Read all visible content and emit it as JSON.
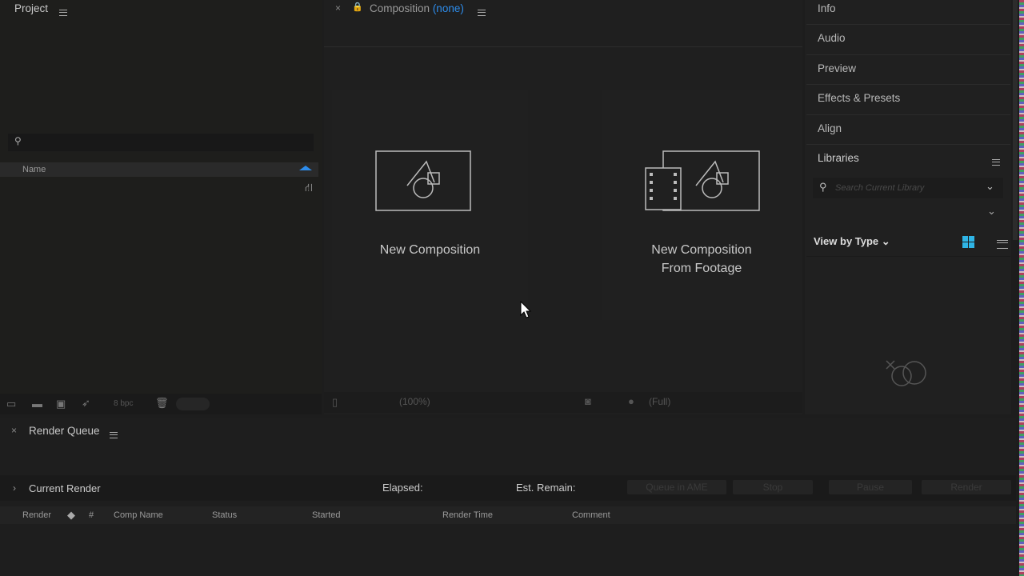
{
  "project": {
    "title": "Project",
    "column_name": "Name",
    "bpc": "8 bpc"
  },
  "composition": {
    "title": "Composition",
    "comp_name": "(none)",
    "zoom": "(100%)",
    "resolution": "(Full)",
    "new_comp": "New Composition",
    "new_comp_footage_line1": "New Composition",
    "new_comp_footage_line2": "From Footage"
  },
  "right_panels": {
    "items": [
      "Info",
      "Audio",
      "Preview",
      "Effects & Presets",
      "Align",
      "Libraries"
    ],
    "search_placeholder": "Search Current Library",
    "view_by": "View by Type"
  },
  "render_queue": {
    "title": "Render Queue",
    "current_render": "Current Render",
    "elapsed": "Elapsed:",
    "est_remain": "Est. Remain:",
    "buttons": [
      "Queue in AME",
      "Stop",
      "Pause",
      "Render"
    ],
    "columns": [
      "Render",
      "#",
      "Comp Name",
      "Status",
      "Started",
      "Render Time",
      "Comment"
    ]
  },
  "colors": {
    "accent": "#2d8ceb",
    "grid_icon": "#2fb5e6"
  }
}
